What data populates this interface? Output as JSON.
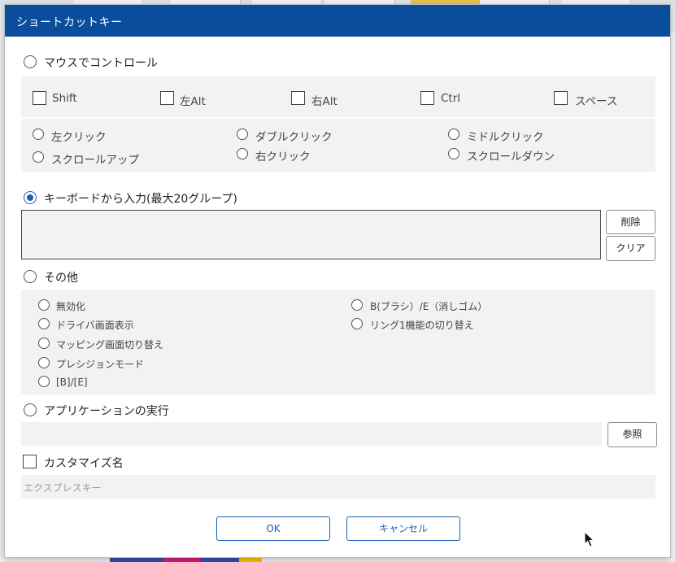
{
  "dialog": {
    "title": "ショートカットキー"
  },
  "mouse": {
    "label": "マウスでコントロール",
    "modifiers": [
      "Shift",
      "左Alt",
      "右Alt",
      "Ctrl",
      "スペース"
    ],
    "clicks": [
      "左クリック",
      "ダブルクリック",
      "ミドルクリック",
      "スクロールアップ",
      "右クリック",
      "スクロールダウン"
    ]
  },
  "keyboard": {
    "label": "キーボードから入力(最大20グループ)",
    "delete_label": "削除",
    "clear_label": "クリア"
  },
  "other": {
    "label": "その他",
    "options_left": [
      "無効化",
      "ドライバ画面表示",
      "マッピング画面切り替え",
      "プレシジョンモード",
      "[B]/[E]"
    ],
    "options_right": [
      "B(ブラシ）/E（消しゴム）",
      "リング1機能の切り替え"
    ]
  },
  "app_exec": {
    "label": "アプリケーションの実行",
    "browse_label": "参照"
  },
  "custom_name": {
    "label": "カスタマイズ名",
    "placeholder": "エクスプレスキー"
  },
  "footer": {
    "ok_label": "OK",
    "cancel_label": "キャンセル"
  }
}
